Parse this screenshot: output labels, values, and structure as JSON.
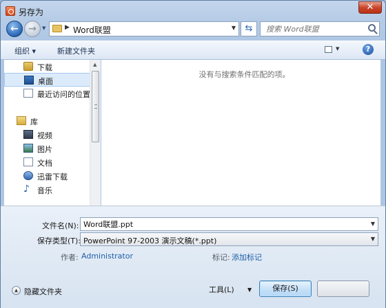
{
  "window": {
    "title": "另存为",
    "close_label": "✕"
  },
  "address": {
    "path": "Word联盟",
    "search_placeholder": "搜索 Word联盟"
  },
  "toolbar": {
    "organize": "组织 ▾",
    "new_folder": "新建文件夹"
  },
  "nav": {
    "items": [
      {
        "label": "下载",
        "icon": "downloads-folder-icon"
      },
      {
        "label": "桌面",
        "icon": "desktop-icon"
      },
      {
        "label": "最近访问的位置",
        "icon": "recent-places-icon"
      },
      {
        "label": "库",
        "icon": "library-icon"
      },
      {
        "label": "视频",
        "icon": "videos-icon"
      },
      {
        "label": "图片",
        "icon": "pictures-icon"
      },
      {
        "label": "文档",
        "icon": "documents-icon"
      },
      {
        "label": "迅雷下载",
        "icon": "xunlei-download-icon"
      },
      {
        "label": "音乐",
        "icon": "music-icon"
      }
    ]
  },
  "content": {
    "empty_message": "没有与搜索条件匹配的项。"
  },
  "form": {
    "filename_label": "文件名(N):",
    "filename_value": "Word联盟.ppt",
    "filetype_label": "保存类型(T):",
    "filetype_value": "PowerPoint 97-2003 演示文稿(*.ppt)",
    "author_label": "作者:",
    "author_value": "Administrator",
    "tags_label": "标记:",
    "tags_value": "添加标记"
  },
  "footer": {
    "hide_folders": "隐藏文件夹",
    "tools_label": "工具(L)",
    "save_label": "保存(S)"
  }
}
